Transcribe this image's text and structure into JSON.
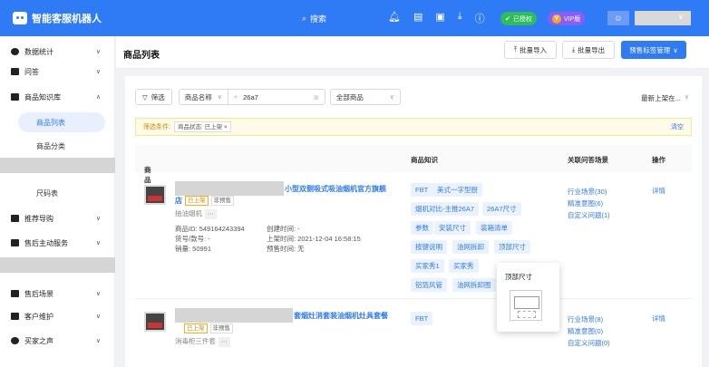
{
  "topbar": {
    "app_name": "智能客服机器人",
    "search_label": "搜索",
    "badge_auth": "已授权",
    "badge_vip": "VIP版",
    "vip_letter": "V"
  },
  "sidebar": {
    "items": [
      {
        "label": "数据统计"
      },
      {
        "label": "问答"
      },
      {
        "label": "商品知识库"
      },
      {
        "label": "推荐导购"
      },
      {
        "label": "售后主动服务"
      },
      {
        "label": "售后场景"
      },
      {
        "label": "客户维护"
      },
      {
        "label": "买家之声"
      }
    ],
    "subs": [
      {
        "label": "商品列表"
      },
      {
        "label": "商品分类"
      },
      {
        "label": "尺码表"
      }
    ]
  },
  "header": {
    "title": "商品列表",
    "import_label": "批量导入",
    "export_label": "批量导出",
    "presale_label": "预售标签管理"
  },
  "filters": {
    "filter_label": "筛选",
    "field_select": "商品名称",
    "search_value": "26a7",
    "scope_select": "全部商品",
    "sort_label": "最新上架在..."
  },
  "condition": {
    "label": "筛选条件:",
    "tag": "商品状态: 已上架",
    "clear": "清空"
  },
  "table": {
    "headers": {
      "product": "商品",
      "knowledge": "商品知识",
      "scenes": "关联问答场景",
      "ops": "操作"
    }
  },
  "rows": [
    {
      "name_visible": "小型双侧吸式吸油烟机官方旗舰",
      "name_line2": "店",
      "status": "已上架",
      "presale": "非预售",
      "category": "抽油烟机",
      "id_line": "商品ID: 549164243394",
      "goods_no": "货号/款号: -",
      "sales": "销量: 50991",
      "created": "创建时间: -",
      "listed": "上架时间: 2021-12-04 16:58:15",
      "presale_time": "预售时间: 无",
      "chips": [
        "FBT",
        "美式一字型厨",
        "烟机对比-主推26A7",
        "26A7尺寸",
        "参数",
        "安装尺寸",
        "装箱清单",
        "按键说明",
        "油网拆卸",
        "顶部尺寸",
        "买家秀1",
        "买家秀",
        "铝箔风管",
        "油网拆卸图"
      ],
      "scenes": [
        "行业场景(30)",
        "精准意图(6)",
        "自定义问题(1)"
      ],
      "op": "详情"
    },
    {
      "name_visible": "套烟灶消套装油烟机灶具套餐",
      "status": "已上架",
      "presale": "非预售",
      "category": "消毒柜三件套",
      "chips": [
        "FBT"
      ],
      "scenes": [
        "行业场景(8)",
        "精准意图(0)",
        "自定义问题(0)"
      ],
      "op": "详情"
    }
  ],
  "popover": {
    "title": "顶部尺寸"
  }
}
